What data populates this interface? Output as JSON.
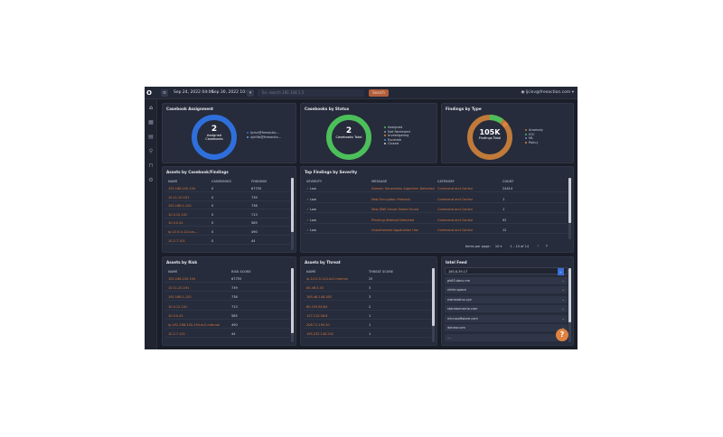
{
  "topbar": {
    "logo": "O",
    "menu_icon": "menu-icon",
    "date_from": "Sep 24, 2022 04:00",
    "date_to": "Sep 30, 2022 10:00",
    "search_placeholder": "Ex: search 192.168.1.5",
    "search_button": "Search",
    "user": "ljcisv@freeaction.com"
  },
  "sidebar": {
    "items": [
      {
        "icon": "home-icon",
        "glyph": "⌂"
      },
      {
        "icon": "grid-icon",
        "glyph": "▦"
      },
      {
        "icon": "document-icon",
        "glyph": "▤"
      },
      {
        "icon": "search-icon",
        "glyph": "⚲"
      },
      {
        "icon": "bookmark-icon",
        "glyph": "⊓"
      },
      {
        "icon": "settings-icon",
        "glyph": "⚙"
      }
    ]
  },
  "casebook_assignment": {
    "title": "Casebook Assignment",
    "center_value": "2",
    "center_label1": "Assigned",
    "center_label2": "Casebooks",
    "legend": [
      "ljcisv@freeactio...",
      "ujkf4b@freeactio..."
    ],
    "colors": [
      "#2f6fdc",
      "#6c9af0"
    ],
    "slices": [
      1,
      1
    ]
  },
  "casebooks_by_status": {
    "title": "Casebooks by Status",
    "center_value": "2",
    "center_label": "Casebooks Total",
    "legend": [
      "Assigned",
      "Not Reviewed",
      "Investigating",
      "Escalate",
      "Closed"
    ],
    "colors": [
      "#4cbf5a",
      "#8f97a8",
      "#e0823f",
      "#4a8fe6",
      "#c9ced8"
    ],
    "slices": [
      2,
      0,
      0,
      0,
      0
    ]
  },
  "findings_by_type": {
    "title": "Findings by Type",
    "center_value": "105K",
    "center_label": "Findings Total",
    "legend": [
      "Anomaly",
      "IOC",
      "ML",
      "Policy"
    ],
    "colors": [
      "#c07a3a",
      "#4cbf5a",
      "#7a86c8",
      "#e0823f"
    ],
    "slices": [
      0.85,
      0.1,
      0.03,
      0.02
    ]
  },
  "assets_casebooks": {
    "title": "Assets by Casebook/Findings",
    "headers": [
      "NAME",
      "CASEBOOKS",
      "FINDINGS"
    ],
    "rows": [
      [
        "192.168.100.194",
        "0",
        "67755"
      ],
      [
        "10.11.20.191",
        "0",
        "739"
      ],
      [
        "192.168.1.120",
        "0",
        "738"
      ],
      [
        "10.0.12.101",
        "0",
        "713"
      ],
      [
        "10.0.0.41",
        "0",
        "585"
      ],
      [
        "ip-10-0-0-124.us-...",
        "0",
        "490"
      ],
      [
        "10.2.7.101",
        "0",
        "44"
      ]
    ]
  },
  "top_findings": {
    "title": "Top Findings by Severity",
    "headers": [
      "SEVERITY",
      "MESSAGE",
      "CATEGORY",
      "COUNT"
    ],
    "rows": [
      [
        "Low",
        "Domain Generation Algorithm Detected",
        "Command and Control",
        "24414"
      ],
      [
        "Low",
        "New Encryption Protocol",
        "Command and Control",
        "1"
      ],
      [
        "Low",
        "New DNS Server Name Found",
        "Command and Control",
        "1"
      ],
      [
        "Low",
        "Phishing Attempt Detected",
        "Command and Control",
        "92"
      ],
      [
        "Low",
        "Unauthorized Application Use",
        "Command and Control",
        "12"
      ]
    ],
    "items_per_page_label": "Items per page:",
    "items_per_page": "10",
    "range": "1 – 10 of 14"
  },
  "assets_by_risk": {
    "title": "Assets by Risk",
    "headers": [
      "NAME",
      "RISK SCORE"
    ],
    "rows": [
      [
        "192.168.100.194",
        "67755"
      ],
      [
        "10.11.20.191",
        "739"
      ],
      [
        "192.168.1.120",
        "738"
      ],
      [
        "10.0.12.101",
        "713"
      ],
      [
        "10.0.0.41",
        "585"
      ],
      [
        "ip-192-168-100-194.ec2.internal",
        "490"
      ],
      [
        "10.2.7.101",
        "44"
      ]
    ]
  },
  "assets_by_threat": {
    "title": "Assets by Threat",
    "headers": [
      "NAME",
      "THREAT SCORE"
    ],
    "rows": [
      [
        "ip-10-0-0-124.ec2.internal",
        "25"
      ],
      [
        "80.46.5.43",
        "3"
      ],
      [
        "165.46.148.185",
        "3"
      ],
      [
        "80.193.65.64",
        "2"
      ],
      [
        "137.110.58.8",
        "1"
      ],
      [
        "206.71.190.20",
        "1"
      ],
      [
        "195.232.140.202",
        "1"
      ]
    ]
  },
  "intel_feed": {
    "title": "Intel Feed",
    "items": [
      "185.8.39.17",
      "pk63.dons.me",
      "nlinkr.space",
      "nstrostatus.xyz",
      "standarmarria.com",
      "microsoftstore.com",
      "dohew.com",
      "...."
    ]
  },
  "help_label": "?"
}
